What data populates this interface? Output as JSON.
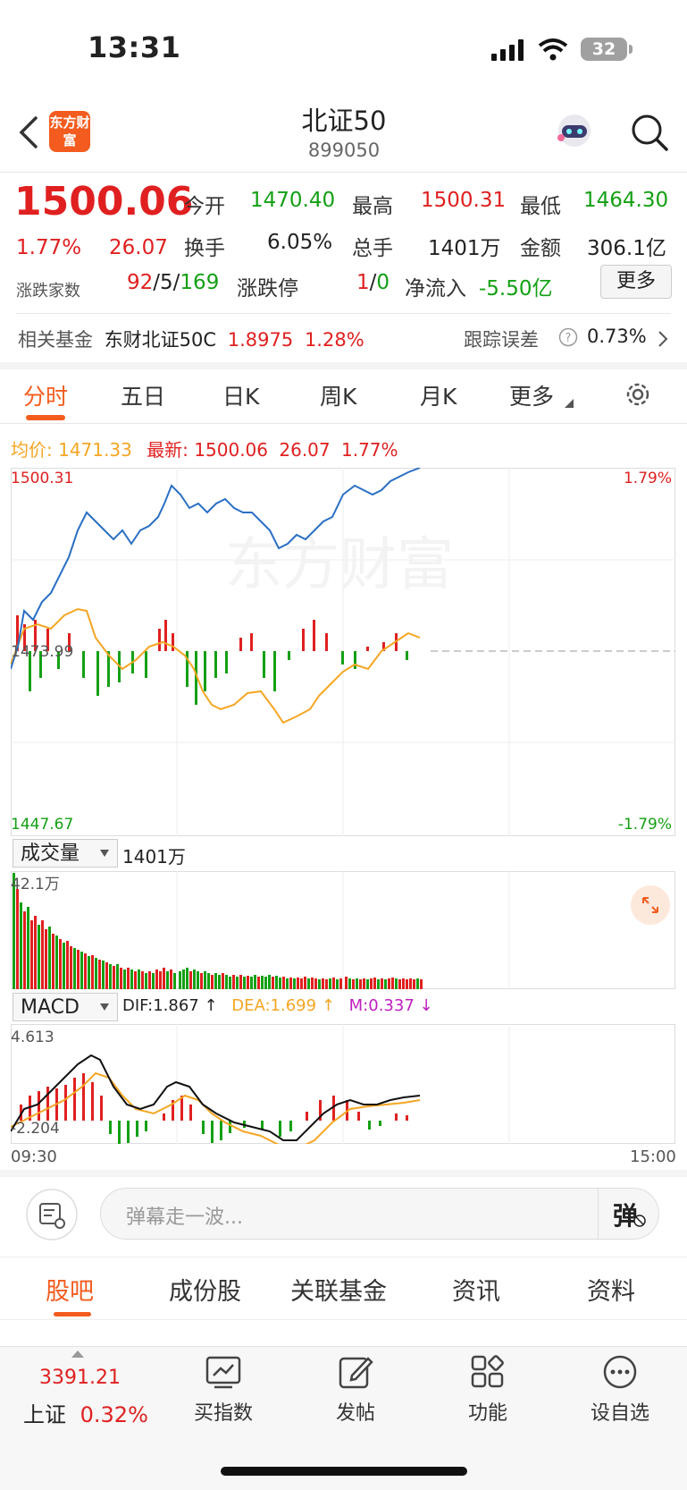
{
  "status_bar": {
    "time": "13:31",
    "battery": "32"
  },
  "header": {
    "logo_text": "东方财富",
    "title": "北证50",
    "code": "899050"
  },
  "quote": {
    "price": "1500.06",
    "change_pct": "1.77%",
    "change": "26.07",
    "open_label": "今开",
    "open": "1470.40",
    "high_label": "最高",
    "high": "1500.31",
    "low_label": "最低",
    "low": "1464.30",
    "turnover_label": "换手",
    "turnover": "6.05%",
    "volume_label": "总手",
    "volume": "1401万",
    "amount_label": "金额",
    "amount": "306.1亿",
    "breadth_label": "涨跌家数",
    "up": "92",
    "flat": "5",
    "down": "169",
    "limit_label": "涨跌停",
    "limit_up": "1",
    "limit_down": "0",
    "netflow_label": "净流入",
    "netflow": "-5.50亿",
    "more_button": "更多"
  },
  "fund": {
    "label": "相关基金",
    "name": "东财北证50C",
    "price": "1.8975",
    "pct": "1.28%",
    "tracking_label": "跟踪误差",
    "tracking": "0.73%"
  },
  "tabs": [
    "分时",
    "五日",
    "日K",
    "周K",
    "月K",
    "更多"
  ],
  "intraday": {
    "avg_label": "均价:",
    "avg": "1471.33",
    "latest_label": "最新:",
    "latest": "1500.06",
    "latest_change": "26.07",
    "latest_pct": "1.77%",
    "y_top": "1500.31",
    "y_mid": "1473.99",
    "y_bottom": "1447.67",
    "pct_top": "1.79%",
    "pct_bottom": "-1.79%"
  },
  "volume_panel": {
    "selector": "成交量",
    "total": "1401万",
    "max": "42.1万"
  },
  "macd_panel": {
    "selector": "MACD",
    "dif": "DIF:1.867 ↑",
    "dea": "DEA:1.699 ↑",
    "m": "M:0.337 ↓",
    "top": "4.613",
    "bottom": "-2.204"
  },
  "time_axis": {
    "start": "09:30",
    "end": "15:00"
  },
  "danmu": {
    "placeholder": "弹幕走一波...",
    "send_icon_text": "弹"
  },
  "bottom_tabs": [
    "股吧",
    "成份股",
    "关联基金",
    "资讯",
    "资料"
  ],
  "bottom_nav": {
    "index_value": "3391.21",
    "index_name": "上证",
    "index_pct": "0.32%",
    "items": [
      "买指数",
      "发帖",
      "功能",
      "设自选"
    ]
  },
  "colors": {
    "up": "#e02020",
    "down": "#14a014",
    "brand": "#f35c1e",
    "price_line": "#2a6fc4",
    "avg_line": "#f5a623"
  }
}
